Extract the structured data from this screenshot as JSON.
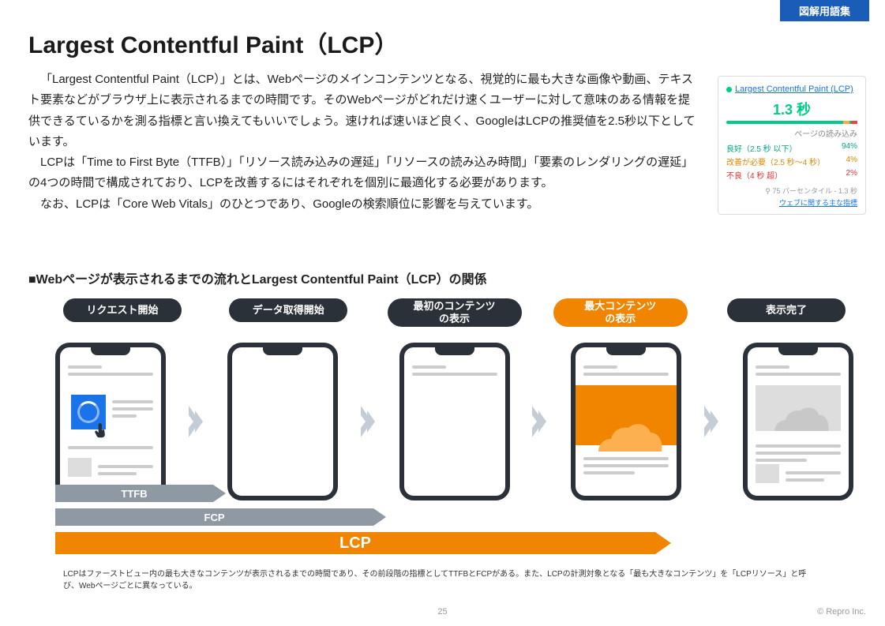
{
  "badge": "図解用語集",
  "title": "Largest Contentful Paint（LCP）",
  "desc_p1": "「Largest Contentful Paint（LCP）」とは、Webページのメインコンテンツとなる、視覚的に最も大きな画像や動画、テキスト要素などがブラウザ上に表示されるまでの時間です。そのWebページがどれだけ速くユーザーに対して意味のある情報を提供できるているかを測る指標と言い換えてもいいでしょう。速ければ速いほど良く、GoogleはLCPの推奨値を2.5秒以下としています。",
  "desc_p2": "LCPは「Time to First Byte（TTFB）」「リソース読み込みの遅延」「リソースの読み込み時間」「要素のレンダリングの遅延」の4つの時間で構成されており、LCPを改善するにはそれぞれを個別に最適化する必要があります。",
  "desc_p3": "なお、LCPは「Core Web Vitals」のひとつであり、Googleの検索順位に影響を与えています。",
  "metrics": {
    "title": "Largest Contentful Paint (LCP)",
    "value": "1.3 秒",
    "sub": "ページの読み込み",
    "rows": [
      {
        "label": "良好（2.5 秒 以下）",
        "pct": "94%"
      },
      {
        "label": "改善が必要（2.5 秒〜4 秒）",
        "pct": "4%"
      },
      {
        "label": "不良（4 秒 超）",
        "pct": "2%"
      }
    ],
    "foot": "⚲ 75 パーセンタイル - 1.3 秒",
    "link": "ウェブに関する主な指標"
  },
  "section_h": "■Webページが表示されるまでの流れとLargest Contentful Paint（LCP）の関係",
  "stages": [
    "リクエスト開始",
    "データ取得開始",
    "最初のコンテンツ\nの表示",
    "最大コンテンツ\nの表示",
    "表示完了"
  ],
  "arrows": {
    "ttfb": "TTFB",
    "fcp": "FCP",
    "lcp": "LCP"
  },
  "footnote": "LCPはファーストビュー内の最も大きなコンテンツが表示されるまでの時間であり、その前段階の指標としてTTFBとFCPがある。また、LCPの計測対象となる「最も大きなコンテンツ」を「LCPリソース」と呼び、Webページごとに異なっている。",
  "pagenum": "25",
  "copy": "© Repro Inc."
}
